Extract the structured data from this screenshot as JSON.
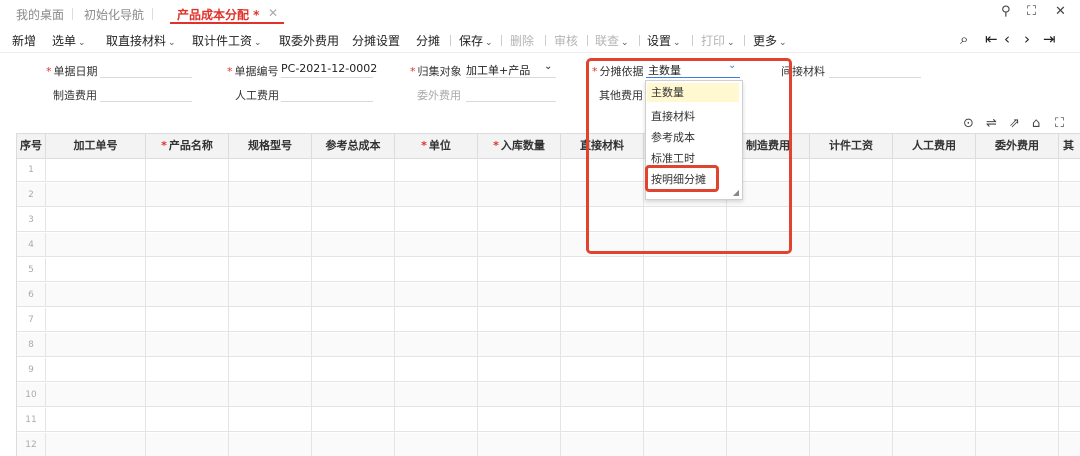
{
  "tabs": [
    {
      "label": "我的桌面"
    },
    {
      "label": "初始化导航"
    },
    {
      "label": "产品成本分配 *"
    }
  ],
  "window_controls": {
    "search": "⚲",
    "restore": "⛶",
    "close": "✕"
  },
  "toolbar": {
    "items": [
      {
        "label": "新增"
      },
      {
        "label": "选单"
      },
      {
        "label": "取直接材料"
      },
      {
        "label": "取计件工资"
      },
      {
        "label": "取委外费用"
      },
      {
        "label": "分摊设置"
      },
      {
        "label": "分摊"
      },
      {
        "label": "保存"
      },
      {
        "label": "删除"
      },
      {
        "label": "审核"
      },
      {
        "label": "联查"
      },
      {
        "label": "设置"
      },
      {
        "label": "打印"
      },
      {
        "label": "更多"
      }
    ]
  },
  "form": {
    "bill_date_label": "单据日期",
    "bill_no_label": "单据编号",
    "bill_no_value": "PC-2021-12-0002",
    "collect_object_label": "归集对象",
    "collect_object_value": "加工单+产品",
    "allocation_basis_label": "分摊依据",
    "allocation_basis_value": "主数量",
    "indirect_material_label": "间接材料",
    "manufacturing_cost_label": "制造费用",
    "labor_cost_label": "人工费用",
    "outsource_cost_label": "委外费用",
    "other_cost_label": "其他费用"
  },
  "dropdown": {
    "options": [
      "主数量",
      "直接材料",
      "参考成本",
      "标准工时",
      "按明细分摊"
    ],
    "selected": "主数量"
  },
  "table": {
    "columns": [
      "序号",
      "加工单号",
      "产品名称",
      "规格型号",
      "参考总成本",
      "单位",
      "入库数量",
      "直接材料",
      "",
      "制造费用",
      "计件工资",
      "人工费用",
      "委外费用",
      "其"
    ],
    "row_numbers": [
      "1",
      "2",
      "3",
      "4",
      "5",
      "6",
      "7",
      "8",
      "9",
      "10",
      "11",
      "12"
    ]
  },
  "colors": {
    "accent": "#e2312b",
    "annotation": "#e1442e",
    "selected_bg": "#fff8d0"
  }
}
